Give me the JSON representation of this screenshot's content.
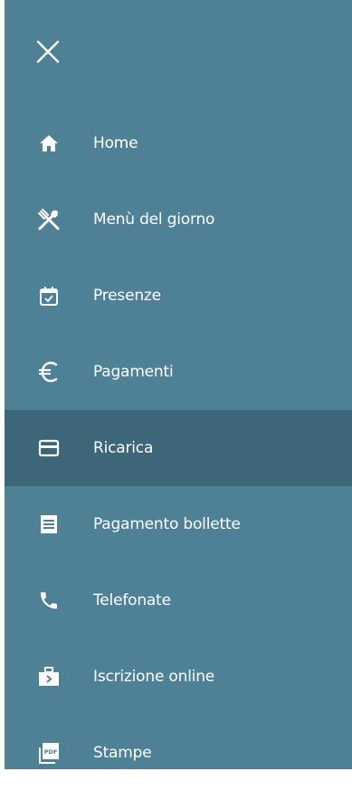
{
  "drawer": {
    "close_icon": "close-icon",
    "background_color": "#4f8196",
    "active_background_color": "#3d6678",
    "icon_color": "#ffffff",
    "active_item": "Ricarica"
  },
  "menu": {
    "items": [
      {
        "label": "Home",
        "icon": "home-icon"
      },
      {
        "label": "Menù del giorno",
        "icon": "fork-knife-icon"
      },
      {
        "label": "Presenze",
        "icon": "calendar-check-icon"
      },
      {
        "label": "Pagamenti",
        "icon": "euro-icon"
      },
      {
        "label": "Ricarica",
        "icon": "credit-card-icon"
      },
      {
        "label": "Pagamento bollette",
        "icon": "bill-icon"
      },
      {
        "label": "Telefonate",
        "icon": "phone-icon"
      },
      {
        "label": "Iscrizione online",
        "icon": "briefcase-icon"
      },
      {
        "label": "Stampe",
        "icon": "pdf-icon"
      }
    ]
  }
}
